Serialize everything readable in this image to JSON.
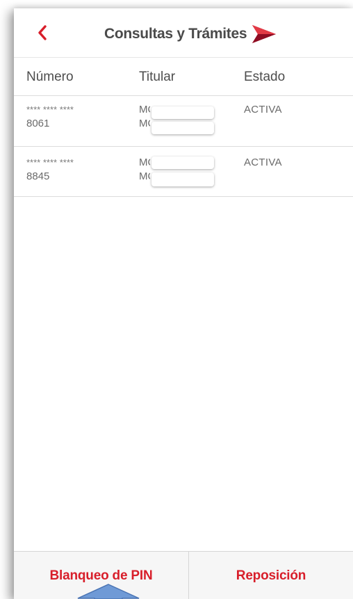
{
  "header": {
    "back_icon": "chevron-left-icon",
    "title": "Consultas y Trámites",
    "logo_icon": "red-arrowhead-logo"
  },
  "table": {
    "columns": [
      "Número",
      "Titular",
      "Estado"
    ],
    "rows": [
      {
        "masked": "**** **** ****",
        "last4": "8061",
        "titular_1": "MO",
        "titular_2": "MONICA",
        "estado": "ACTIVA"
      },
      {
        "masked": "**** **** ****",
        "last4": "8845",
        "titular_1": "MO",
        "titular_2": "MO",
        "estado": "ACTIVA"
      }
    ]
  },
  "bottom": {
    "left_label": "Blanqueo de PIN",
    "right_label": "Reposición"
  },
  "colors": {
    "accent_red": "#d81e2a",
    "text_gray": "#6a6a6a",
    "annotation_blue": "#6f9ad6"
  }
}
